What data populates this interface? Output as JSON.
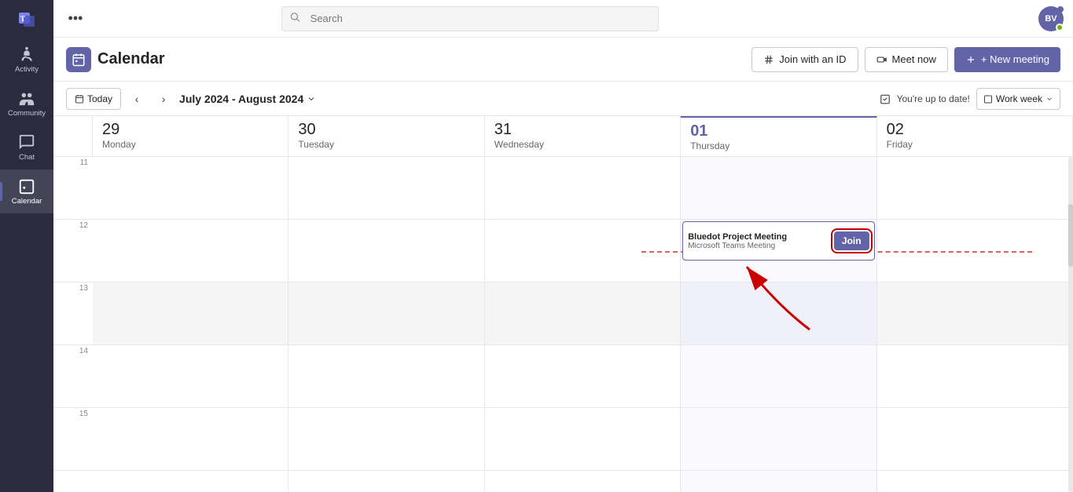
{
  "app": {
    "title": "Microsoft Teams"
  },
  "sidebar": {
    "items": [
      {
        "id": "activity",
        "label": "Activity",
        "icon": "activity-icon"
      },
      {
        "id": "community",
        "label": "Community",
        "icon": "community-icon"
      },
      {
        "id": "chat",
        "label": "Chat",
        "icon": "chat-icon"
      },
      {
        "id": "calendar",
        "label": "Calendar",
        "icon": "calendar-icon",
        "active": true
      }
    ]
  },
  "topbar": {
    "search_placeholder": "Search",
    "more_label": "•••",
    "avatar_initials": "BV"
  },
  "cal_header": {
    "title": "Calendar",
    "join_id_label": "Join with an ID",
    "meet_now_label": "Meet now",
    "new_meeting_label": "+ New meeting"
  },
  "cal_toolbar": {
    "today_label": "Today",
    "date_range": "July 2024 - August 2024",
    "up_to_date": "You're up to date!",
    "view_label": "Work week"
  },
  "calendar": {
    "days": [
      {
        "num": "29",
        "name": "Monday",
        "today": false
      },
      {
        "num": "30",
        "name": "Tuesday",
        "today": false
      },
      {
        "num": "31",
        "name": "Wednesday",
        "today": false
      },
      {
        "num": "01",
        "name": "Thursday",
        "today": true
      },
      {
        "num": "02",
        "name": "Friday",
        "today": false
      }
    ],
    "time_slots": [
      "11",
      "12",
      "13",
      "14",
      "15"
    ],
    "meeting": {
      "title": "Bluedot Project Meeting",
      "subtitle": "Microsoft Teams Meeting",
      "join_label": "Join"
    }
  }
}
